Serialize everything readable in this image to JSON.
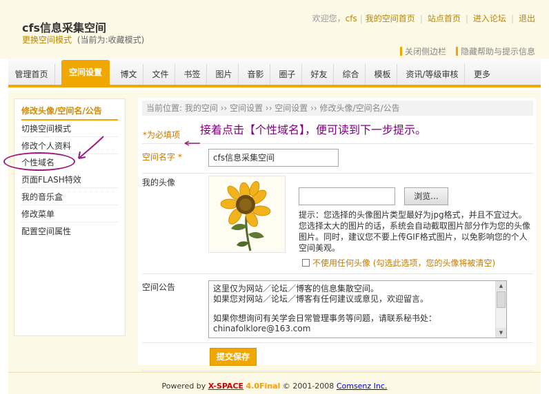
{
  "header": {
    "site_title": "cfs信息采集空间",
    "mode_link": "更换空间模式",
    "mode_note": "(当前为:收藏模式)",
    "welcome": "欢迎您，",
    "username": "cfs",
    "links": [
      "我的空间首页",
      "站点首页",
      "进入论坛",
      "退出"
    ],
    "close_sidebar": "关闭侧边栏",
    "hide_help": "隐藏帮助与提示信息"
  },
  "nav": {
    "items": [
      "管理首页",
      "空间设置",
      "博文",
      "文件",
      "书签",
      "图片",
      "音影",
      "圈子",
      "好友",
      "综合",
      "模板",
      "资讯/等级审核",
      "更多"
    ],
    "active": "空间设置"
  },
  "sidebar": {
    "heading": "修改头像/空间名/公告",
    "items": [
      "切换空间模式",
      "修改个人资料",
      "个性域名",
      "页面FLASH特效",
      "我的音乐盒",
      "修改菜单",
      "配置空间属性"
    ]
  },
  "content": {
    "breadcrumb": "当前位置: 我的空间 ›› 空间设置 ›› 空间设置 ›› 修改头像/空间名/公告",
    "required_note": "*为必填项",
    "instruction": "接着点击【个性域名】，便可读到下一步提示。",
    "space_name_label": "空间名字 *",
    "space_name_value": "cfs信息采集空间",
    "avatar_label": "我的头像",
    "browse_label": "浏览...",
    "avatar_hint": "提示：您选择的头像图片类型最好为jpg格式，并且不宜过大。您选择太大的图片的话，系统会自动截取图片部分作为您的头像图片。同时，建议您不要上传GIF格式图片，以免影响您的个人空间美观。",
    "no_avatar_label": "不使用任何头像 (勾选此选项，您的头像将被清空)",
    "announcement_label": "空间公告",
    "announcement_lines": [
      "这里仅为网站／论坛／博客的信息集散空间。",
      "如果您对网站／论坛／博客有任何建议或意见，欢迎留言。",
      "",
      "如果你想询问有关学会日常管理事务等问题，请联系秘书处：",
      "chinafolklore@163.com"
    ],
    "submit_label": "提交保存"
  },
  "footer": {
    "powered_by": "Powered by",
    "product": "X-SPACE",
    "version": "4.0Final",
    "copyright": "© 2001-2008",
    "company": "Comsenz Inc."
  }
}
